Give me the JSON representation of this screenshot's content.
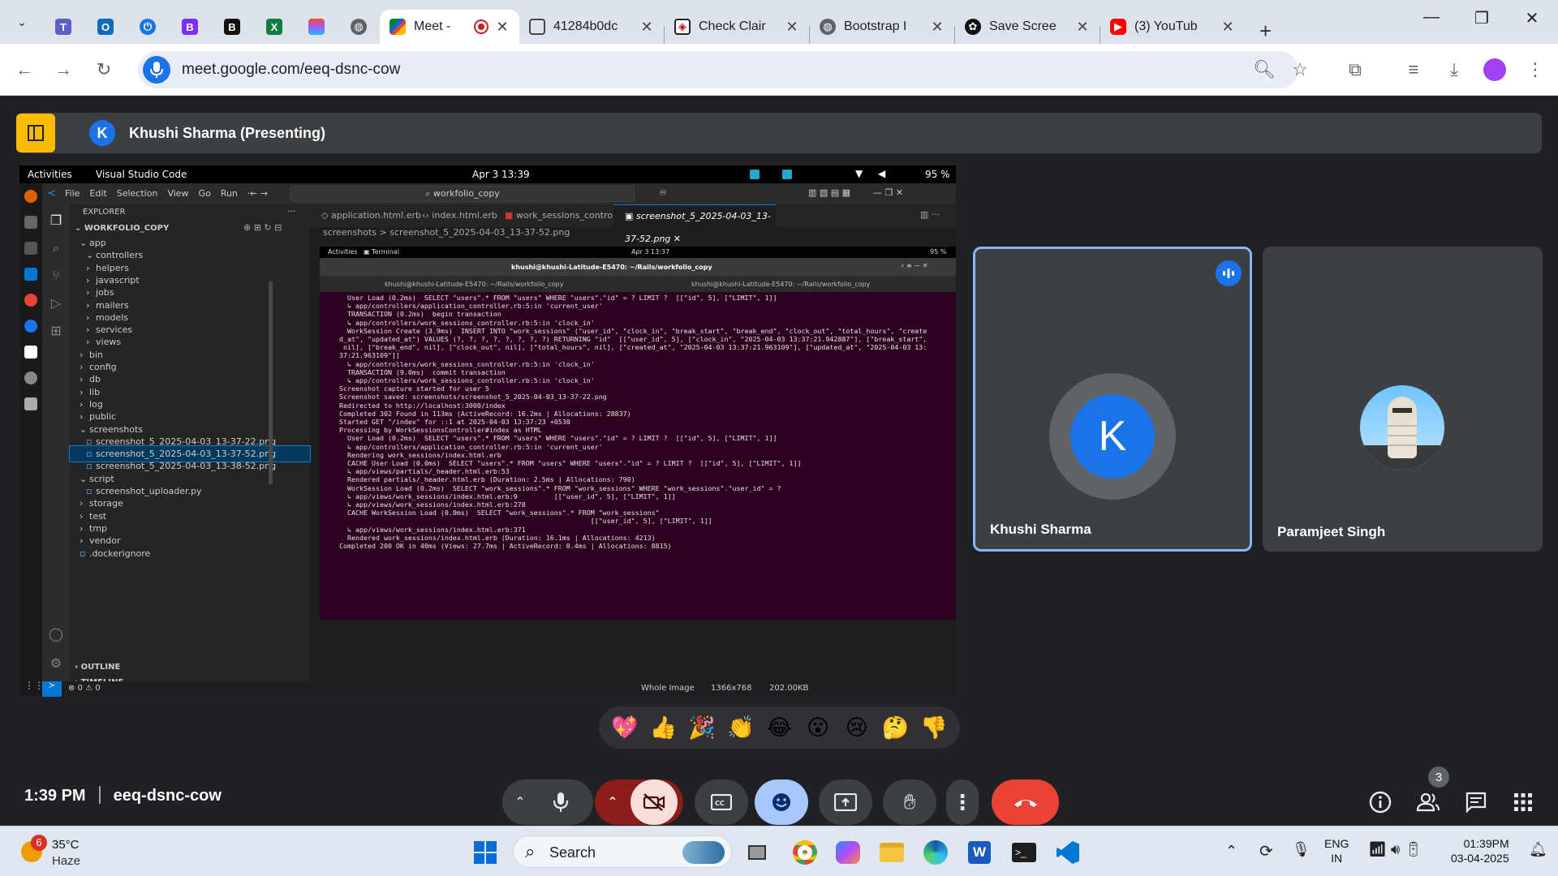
{
  "browser": {
    "tabs": [
      {
        "title": "Meet -",
        "active": true
      },
      {
        "title": "41284b0dc"
      },
      {
        "title": "Check Clair"
      },
      {
        "title": "Bootstrap I"
      },
      {
        "title": "Save Scree"
      },
      {
        "title": "(3) YouTub"
      }
    ],
    "url": "meet.google.com/eeq-dsnc-cow"
  },
  "meet": {
    "presenter_initial": "K",
    "presenting_title": "Khushi Sharma (Presenting)",
    "participants": [
      {
        "name": "Khushi Sharma",
        "initial": "K",
        "speaking": true
      },
      {
        "name": "Paramjeet Singh"
      }
    ],
    "time": "1:39 PM",
    "meeting_code": "eeq-dsnc-cow",
    "participant_count": "3",
    "reactions": [
      "💖",
      "👍",
      "🎉",
      "👏",
      "😂",
      "😮",
      "😢",
      "🤔",
      "👎"
    ]
  },
  "shared_screen": {
    "topbar": {
      "activities": "Activities",
      "app": "Visual Studio Code",
      "datetime": "Apr 3  13:39",
      "battery": "95 %"
    },
    "vscode": {
      "menu": [
        "File",
        "Edit",
        "Selection",
        "View",
        "Go",
        "Run",
        "···"
      ],
      "search": "workfolio_copy",
      "explorer_title": "EXPLORER",
      "workspace": "WORKFOLIO_COPY",
      "tree": [
        {
          "label": "app",
          "indent": 1,
          "open": true
        },
        {
          "label": "controllers",
          "indent": 2,
          "open": true
        },
        {
          "label": "helpers",
          "indent": 2
        },
        {
          "label": "javascript",
          "indent": 2
        },
        {
          "label": "jobs",
          "indent": 2
        },
        {
          "label": "mailers",
          "indent": 2
        },
        {
          "label": "models",
          "indent": 2
        },
        {
          "label": "services",
          "indent": 2
        },
        {
          "label": "views",
          "indent": 2
        },
        {
          "label": "bin",
          "indent": 1
        },
        {
          "label": "config",
          "indent": 1
        },
        {
          "label": "db",
          "indent": 1
        },
        {
          "label": "lib",
          "indent": 1
        },
        {
          "label": "log",
          "indent": 1
        },
        {
          "label": "public",
          "indent": 1
        },
        {
          "label": "screenshots",
          "indent": 1,
          "open": true
        },
        {
          "label": "screenshot_5_2025-04-03_13-37-22.png",
          "indent": 2,
          "file": true
        },
        {
          "label": "screenshot_5_2025-04-03_13-37-52.png",
          "indent": 2,
          "file": true,
          "selected": true
        },
        {
          "label": "screenshot_5_2025-04-03_13-38-52.png",
          "indent": 2,
          "file": true
        },
        {
          "label": "script",
          "indent": 1,
          "open": true
        },
        {
          "label": "screenshot_uploader.py",
          "indent": 2,
          "file": true
        },
        {
          "label": "storage",
          "indent": 1
        },
        {
          "label": "test",
          "indent": 1
        },
        {
          "label": "tmp",
          "indent": 1
        },
        {
          "label": "vendor",
          "indent": 1
        },
        {
          "label": ".dockerignore",
          "indent": 1,
          "file": true
        }
      ],
      "outline": "OUTLINE",
      "timeline": "TIMELINE",
      "editor_tabs": [
        "application.html.erb",
        "index.html.erb",
        "work_sessions_controller.rb",
        "screenshot_5_2025-04-03_13-37-52.png"
      ],
      "breadcrumb": "screenshots  >  screenshot_5_2025-04-03_13-37-52.png",
      "status_left": "⊗ 0 ⚠ 0",
      "status_right": [
        "Whole Image",
        "1366x768",
        "202.00KB"
      ]
    },
    "terminal": {
      "activities": "Activities",
      "app": "Terminal",
      "datetime": "Apr 3  13:37",
      "battery": "95 %",
      "title": "khushi@khushi-Latitude-E5470: ~/Rails/workfolio_copy",
      "tab1": "khushi@khushi-Latitude-E5470: ~/Rails/workfolio_copy",
      "tab2": "khushi@khushi-Latitude-E5470: ~/Rails/workfolio_copy",
      "lines": [
        "  User Load (0.2ms)  SELECT \"users\".* FROM \"users\" WHERE \"users\".\"id\" = ? LIMIT ?  [[\"id\", 5], [\"LIMIT\", 1]]",
        "  ↳ app/controllers/application_controller.rb:5:in 'current_user'",
        "  TRANSACTION (0.2ms)  begin transaction",
        "  ↳ app/controllers/work_sessions_controller.rb:5:in 'clock_in'",
        "  WorkSession Create (3.9ms)  INSERT INTO \"work_sessions\" (\"user_id\", \"clock_in\", \"break_start\", \"break_end\", \"clock_out\", \"total_hours\", \"create",
        "d_at\", \"updated_at\") VALUES (?, ?, ?, ?, ?, ?, ?, ?) RETURNING \"id\"  [[\"user_id\", 5], [\"clock_in\", \"2025-04-03 13:37:21.942887\"], [\"break_start\",",
        " nil], [\"break_end\", nil], [\"clock_out\", nil], [\"total_hours\", nil], [\"created_at\", \"2025-04-03 13:37:21.963109\"], [\"updated_at\", \"2025-04-03 13:",
        "37:21.963109\"]]",
        "  ↳ app/controllers/work_sessions_controller.rb:5:in 'clock_in'",
        "  TRANSACTION (9.0ms)  commit transaction",
        "  ↳ app/controllers/work_sessions_controller.rb:5:in 'clock_in'",
        "Screenshot capture started for user 5",
        "Screenshot saved: screenshots/screenshot_5_2025-04-03_13-37-22.png",
        "Redirected to http://localhost:3000/index",
        "Completed 302 Found in 113ms (ActiveRecord: 16.2ms | Allocations: 28837)",
        "",
        "",
        "Started GET \"/index\" for ::1 at 2025-04-03 13:37:23 +0530",
        "Processing by WorkSessionsController#index as HTML",
        "  User Load (0.2ms)  SELECT \"users\".* FROM \"users\" WHERE \"users\".\"id\" = ? LIMIT ?  [[\"id\", 5], [\"LIMIT\", 1]]",
        "  ↳ app/controllers/application_controller.rb:5:in 'current_user'",
        "  Rendering work_sessions/index.html.erb",
        "  CACHE User Load (0.0ms)  SELECT \"users\".* FROM \"users\" WHERE \"users\".\"id\" = ? LIMIT ?  [[\"id\", 5], [\"LIMIT\", 1]]",
        "  ↳ app/views/partials/_header.html.erb:53",
        "  Rendered partials/_header.html.erb (Duration: 2.5ms | Allocations: 790)",
        "  WorkSession Load (0.2ms)  SELECT \"work_sessions\".* FROM \"work_sessions\" WHERE \"work_sessions\".\"user_id\" = ?",
        "  ↳ app/views/work_sessions/index.html.erb:9         [[\"user_id\", 5], [\"LIMIT\", 1]]",
        "  ↳ app/views/work_sessions/index.html.erb:278",
        "  CACHE WorkSession Load (0.0ms)  SELECT \"work_sessions\".* FROM \"work_sessions\"",
        "                                                              [[\"user_id\", 5], [\"LIMIT\", 1]]",
        "  ↳ app/views/work_sessions/index.html.erb:371",
        "  Rendered work_sessions/index.html.erb (Duration: 16.1ms | Allocations: 4213)",
        "Completed 200 OK in 40ms (Views: 27.7ms | ActiveRecord: 0.4ms | Allocations: 8815)"
      ]
    }
  },
  "taskbar": {
    "weather_badge": "6",
    "temperature": "35°C",
    "condition": "Haze",
    "search_label": "Search",
    "lang1": "ENG",
    "lang2": "IN",
    "time": "01:39PM",
    "date": "03-04-2025"
  },
  "colors": {
    "meet_bg": "#202124",
    "accent": "#1a73e8",
    "end_call": "#ea4335",
    "speaking_border": "#8ab4f8",
    "terminal_bg": "#2c001e"
  }
}
